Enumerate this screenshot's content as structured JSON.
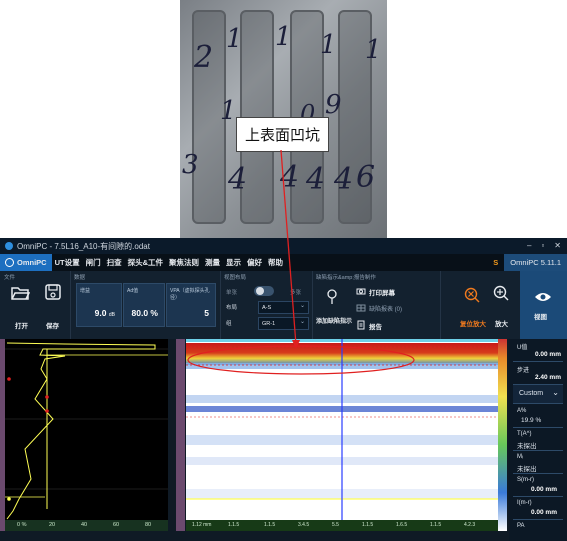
{
  "photo": {
    "callout_label": "上表面凹坑",
    "handwritten": [
      "2",
      "1",
      "1",
      "1",
      "1",
      "1",
      "0",
      "9",
      "3",
      "4",
      "4",
      "4",
      "4",
      "6"
    ]
  },
  "titlebar": {
    "title": "OmniPC - 7.5L16_A10-有间隙的.odat",
    "controls": [
      "–",
      "▫",
      "✕"
    ]
  },
  "menubar": {
    "brand": "OmniPC",
    "items": [
      "UT设置",
      "闸门",
      "扫查",
      "探头&工件",
      "聚焦法则",
      "测量",
      "显示",
      "偏好",
      "帮助"
    ],
    "warning": "S",
    "version": "OmniPC 5.11.1"
  },
  "ribbon": {
    "file_section": {
      "title": "文件",
      "open_label": "打开",
      "save_label": "保存"
    },
    "data_section": {
      "title": "数据",
      "cards": [
        {
          "label": "增益",
          "value": "9.0",
          "unit": "dB"
        },
        {
          "label": "Ad值",
          "value": "80.0 %"
        },
        {
          "label": "VPA（虚拟探头孔径）",
          "value": "5"
        }
      ]
    },
    "layout_section": {
      "title": "视图布局",
      "seg_left": "单张",
      "seg_right": "多张",
      "rows": [
        {
          "label": "布局",
          "value": "A-S"
        },
        {
          "label": "组",
          "value": "GR-1"
        }
      ]
    },
    "report_section": {
      "title": "缺陷指示&amp;报告制作",
      "add_label": "添加缺陷指示",
      "print_label": "打印屏幕",
      "defect_table_label": "缺陷报表 (0)",
      "report_label": "报告"
    },
    "zoom_section": {
      "reset_label": "复位放大",
      "zoom_label": "放大"
    },
    "view_label": "视图"
  },
  "ascan": {
    "x_ticks": [
      "0 %",
      "20",
      "40",
      "60",
      "80"
    ],
    "x_ticks_pct": [
      0,
      20,
      40,
      60,
      80
    ]
  },
  "cscan": {
    "x_ticks": [
      "1.12 mm",
      "1.1.5",
      "1.1.5",
      "3.4.5",
      "5.5",
      "1.1.5",
      "1.6.5",
      "1.1.5",
      "4.2.3"
    ]
  },
  "right_panel": {
    "u_label": "U值",
    "u_value": "0.00 mm",
    "step_label": "步进",
    "step_value": "2.40 mm",
    "mode_value": "Custom",
    "readings": [
      {
        "label": "A%",
        "value": "19.9 %"
      },
      {
        "label": "T(A^)",
        "value": "未探出"
      },
      {
        "label": "Mᵢ",
        "value": "未探出"
      },
      {
        "label": "S(m-r)",
        "value": "0.00 mm"
      },
      {
        "label": "I(m-r)",
        "value": "0.00 mm"
      },
      {
        "label": "PA",
        "value": ""
      }
    ]
  },
  "colors": {
    "accent": "#1d6fc0",
    "warning": "#f39a1c",
    "zoom_reset": "#f07a1e",
    "ascan_signal": "#ffff55",
    "cursor_blue": "#2a3cff",
    "marker_red": "#e02020"
  }
}
